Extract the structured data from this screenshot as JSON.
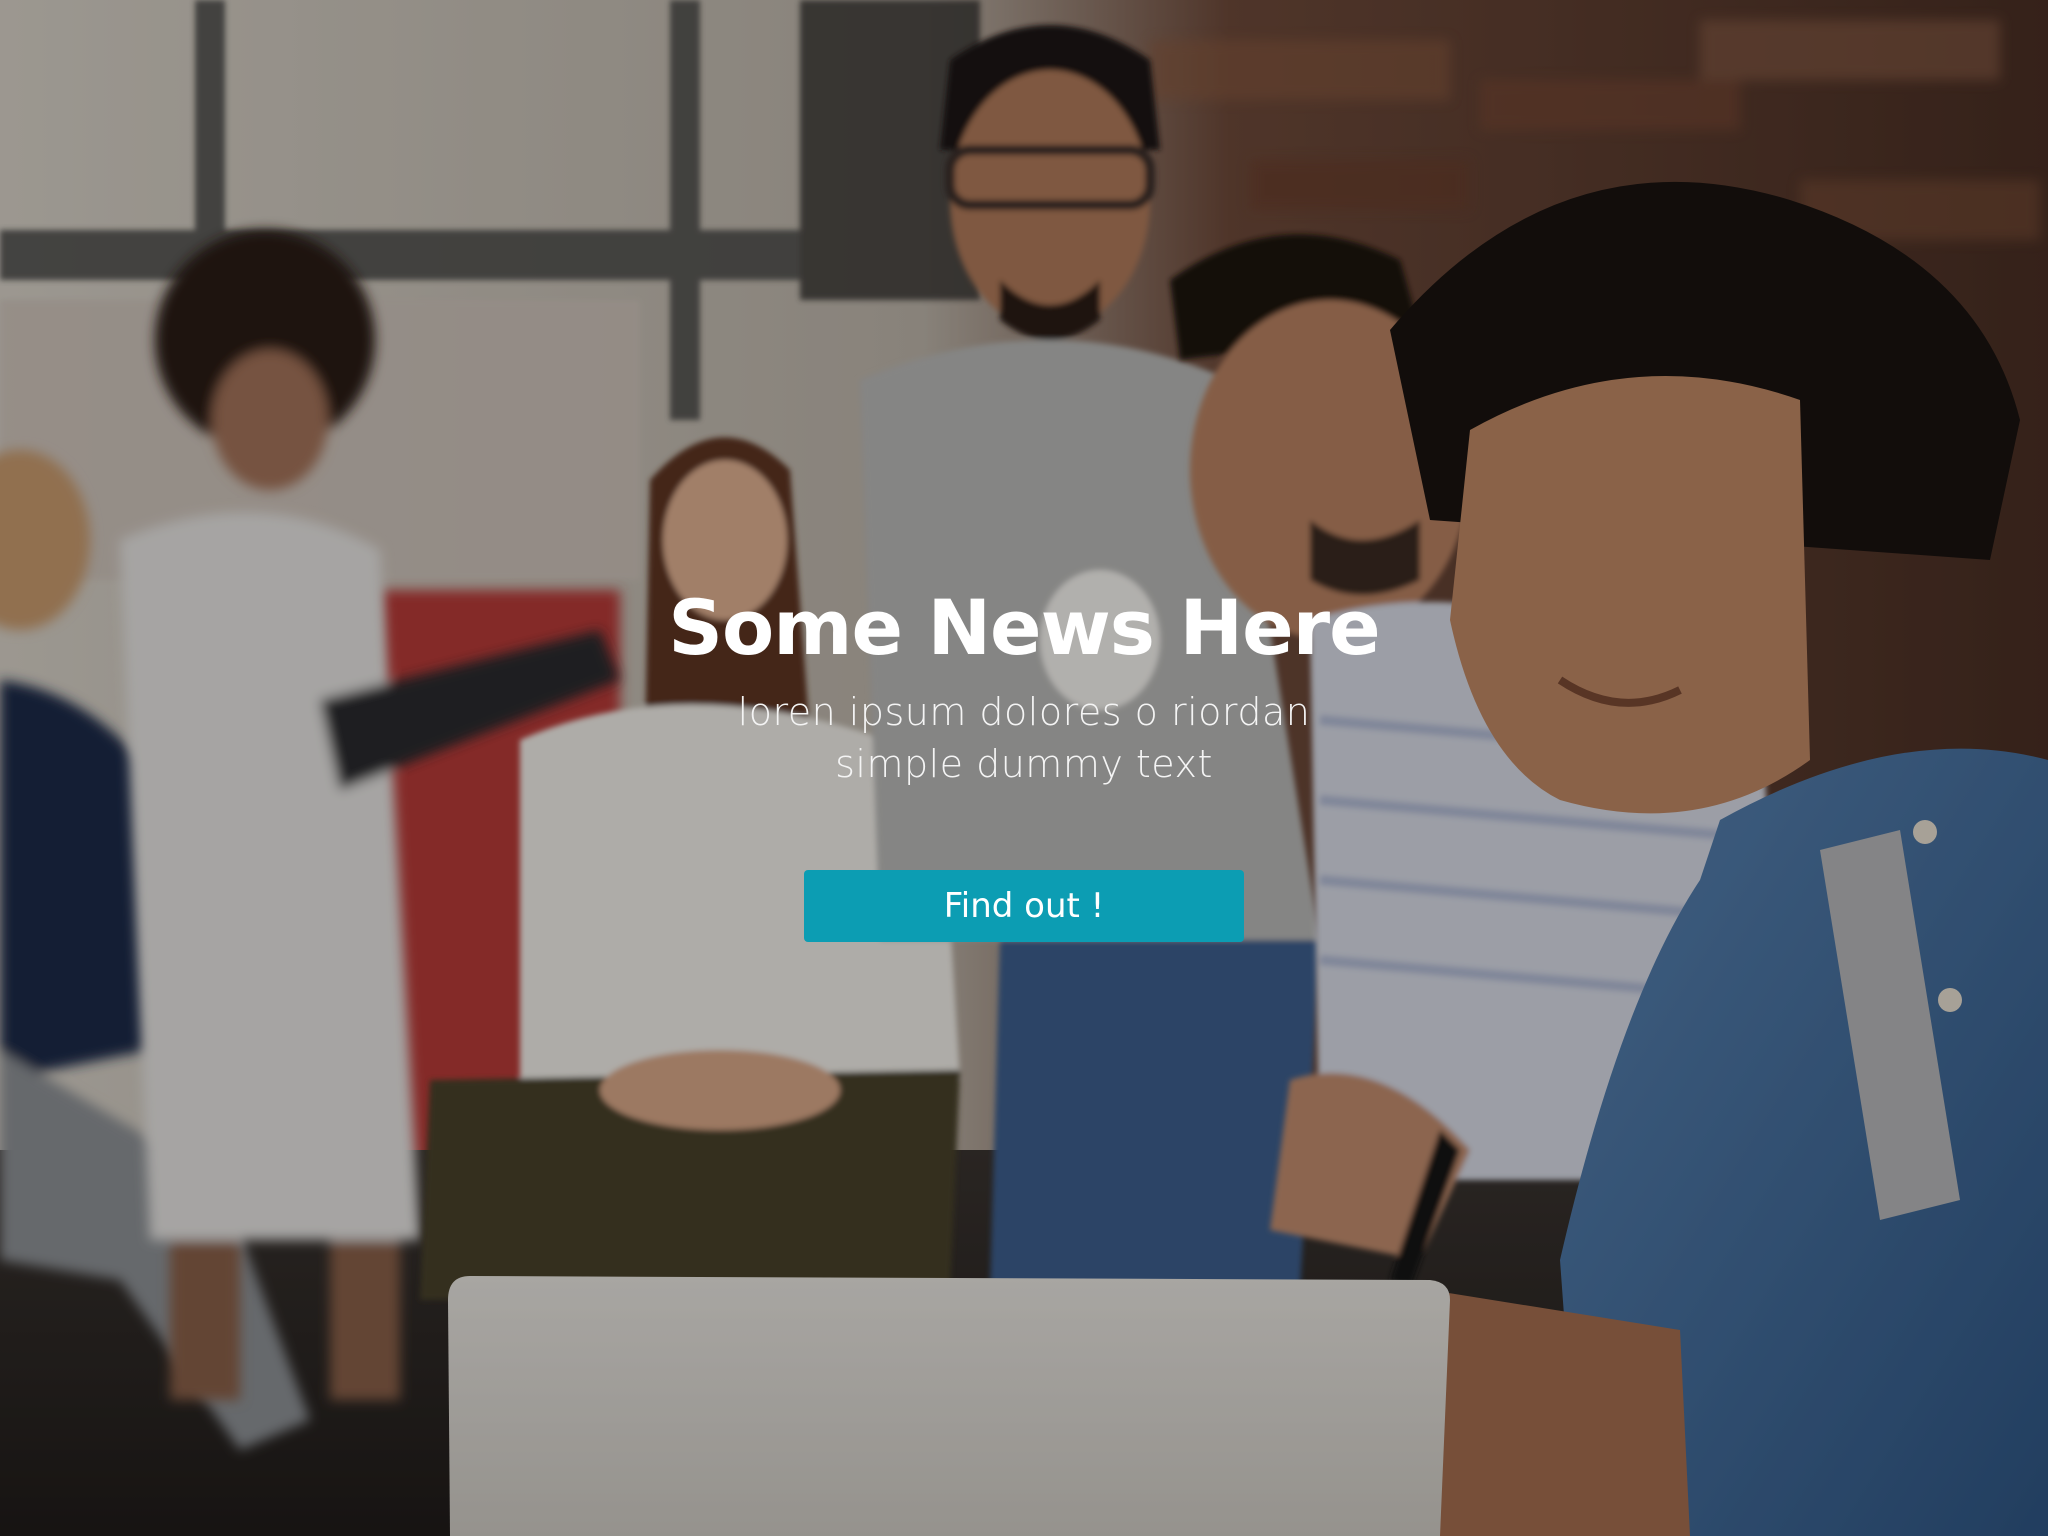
{
  "hero": {
    "headline": "Some News Here",
    "subtitle_line1": "loren ipsum dolores o riordan",
    "subtitle_line2": "simple dummy text",
    "button_label": "Find out !",
    "button_color": "#0c9db3",
    "background_image": "group-of-people-looking-at-laptop-photo"
  }
}
